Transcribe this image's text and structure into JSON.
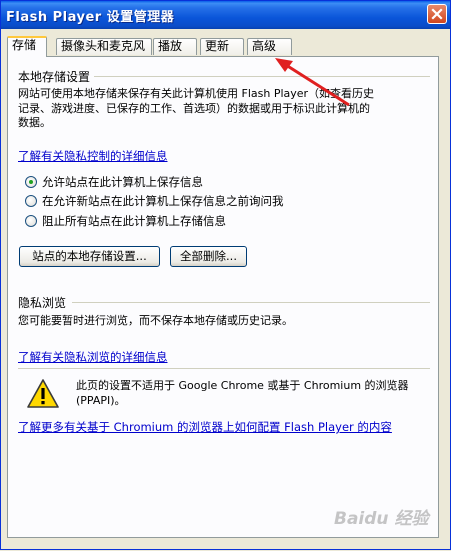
{
  "window": {
    "title": "Flash Player 设置管理器"
  },
  "tabs": [
    {
      "label": "存储",
      "active": true
    },
    {
      "label": "摄像头和麦克风",
      "active": false
    },
    {
      "label": "播放",
      "active": false
    },
    {
      "label": "更新",
      "active": false
    },
    {
      "label": "高级",
      "active": false
    }
  ],
  "storage": {
    "title": "本地存储设置",
    "description_lines": [
      "网站可使用本地存储来保存有关此计算机使用 Flash Player（如查看历史",
      "记录、游戏进度、已保存的工作、首选项）的数据或用于标识此计算机的",
      "数据。"
    ],
    "learn_more_link": "了解有关隐私控制的详细信息",
    "options": [
      {
        "label": "允许站点在此计算机上保存信息",
        "checked": true
      },
      {
        "label": "在允许新站点在此计算机上保存信息之前询问我",
        "checked": false
      },
      {
        "label": "阻止所有站点在此计算机上存储信息",
        "checked": false
      }
    ],
    "site_settings_button": "站点的本地存储设置...",
    "delete_all_button": "全部删除..."
  },
  "private_browsing": {
    "title": "隐私浏览",
    "description": "您可能要暂时进行浏览，而不保存本地存储或历史记录。",
    "learn_more_link": "了解有关隐私浏览的详细信息"
  },
  "notice": {
    "icon": "warning-icon",
    "line1": "此页的设置不适用于 Google Chrome 或基于 Chromium 的浏览器",
    "line2": "(PPAPI)。",
    "link": "了解更多有关基于 Chromium 的浏览器上如何配置 Flash Player 的内容"
  },
  "watermark": "Baidu 经验",
  "colors": {
    "titlebar": "#0A55D9",
    "link": "#0000CC",
    "annotation_arrow": "#E02020"
  }
}
